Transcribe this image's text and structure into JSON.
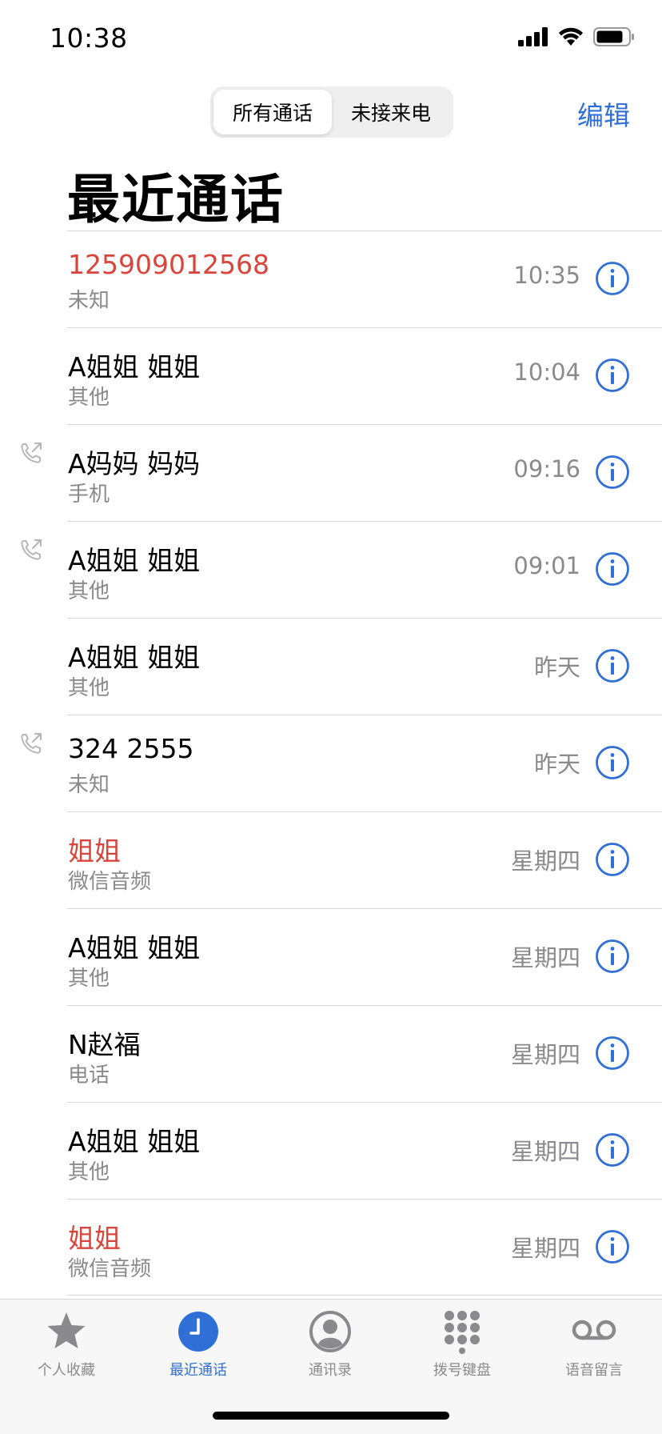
{
  "status_bar": {
    "time": "10:38"
  },
  "header": {
    "segments": [
      "所有通话",
      "未接来电"
    ],
    "active_segment": 0,
    "edit_label": "编辑",
    "title": "最近通话"
  },
  "colors": {
    "accent": "#2f6fd6",
    "missed": "#d9443b",
    "secondary_text": "#8a8a8e"
  },
  "calls": [
    {
      "name": "125909012568",
      "type": "未知",
      "time": "10:35",
      "missed": true,
      "outgoing": false
    },
    {
      "name": "A姐姐 姐姐",
      "type": "其他",
      "time": "10:04",
      "missed": false,
      "outgoing": false
    },
    {
      "name": "A妈妈 妈妈",
      "type": "手机",
      "time": "09:16",
      "missed": false,
      "outgoing": true
    },
    {
      "name": "A姐姐 姐姐",
      "type": "其他",
      "time": "09:01",
      "missed": false,
      "outgoing": true
    },
    {
      "name": "A姐姐 姐姐",
      "type": "其他",
      "time": "昨天",
      "missed": false,
      "outgoing": false
    },
    {
      "name": "324 2555",
      "type": "未知",
      "time": "昨天",
      "missed": false,
      "outgoing": true
    },
    {
      "name": "姐姐",
      "type": "微信音频",
      "time": "星期四",
      "missed": true,
      "outgoing": false
    },
    {
      "name": "A姐姐 姐姐",
      "type": "其他",
      "time": "星期四",
      "missed": false,
      "outgoing": false
    },
    {
      "name": "N赵福",
      "type": "电话",
      "time": "星期四",
      "missed": false,
      "outgoing": false
    },
    {
      "name": "A姐姐 姐姐",
      "type": "其他",
      "time": "星期四",
      "missed": false,
      "outgoing": false
    },
    {
      "name": "姐姐",
      "type": "微信音频",
      "time": "星期四",
      "missed": true,
      "outgoing": false
    }
  ],
  "tab_bar": {
    "tabs": [
      {
        "label": "个人收藏",
        "icon": "star-icon"
      },
      {
        "label": "最近通话",
        "icon": "clock-icon"
      },
      {
        "label": "通讯录",
        "icon": "contact-icon"
      },
      {
        "label": "拨号键盘",
        "icon": "keypad-icon"
      },
      {
        "label": "语音留言",
        "icon": "voicemail-icon"
      }
    ],
    "active_index": 1
  }
}
